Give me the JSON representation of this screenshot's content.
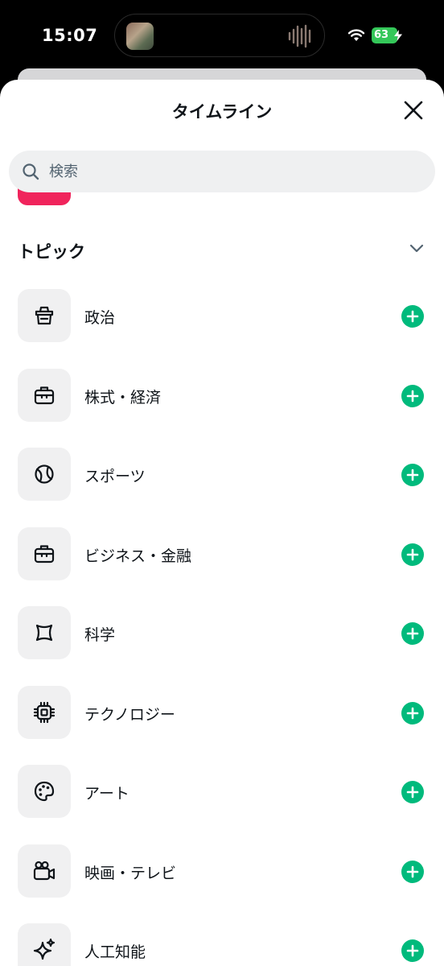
{
  "status_bar": {
    "time": "15:07",
    "battery": "63"
  },
  "sheet": {
    "title": "タイムライン"
  },
  "search": {
    "placeholder": "検索"
  },
  "section": {
    "title": "トピック"
  },
  "colors": {
    "accent_green": "#00ba7c",
    "pink_chip": "#f0245c",
    "battery_green": "#34c759"
  },
  "topics": [
    {
      "label": "政治",
      "icon": "ballot-box-icon"
    },
    {
      "label": "株式・経済",
      "icon": "briefcase-icon"
    },
    {
      "label": "スポーツ",
      "icon": "tennis-ball-icon"
    },
    {
      "label": "ビジネス・金融",
      "icon": "briefcase-icon"
    },
    {
      "label": "科学",
      "icon": "atom-icon"
    },
    {
      "label": "テクノロジー",
      "icon": "chip-icon"
    },
    {
      "label": "アート",
      "icon": "palette-icon"
    },
    {
      "label": "映画・テレビ",
      "icon": "video-camera-icon"
    },
    {
      "label": "人工知能",
      "icon": "sparkle-icon"
    }
  ]
}
